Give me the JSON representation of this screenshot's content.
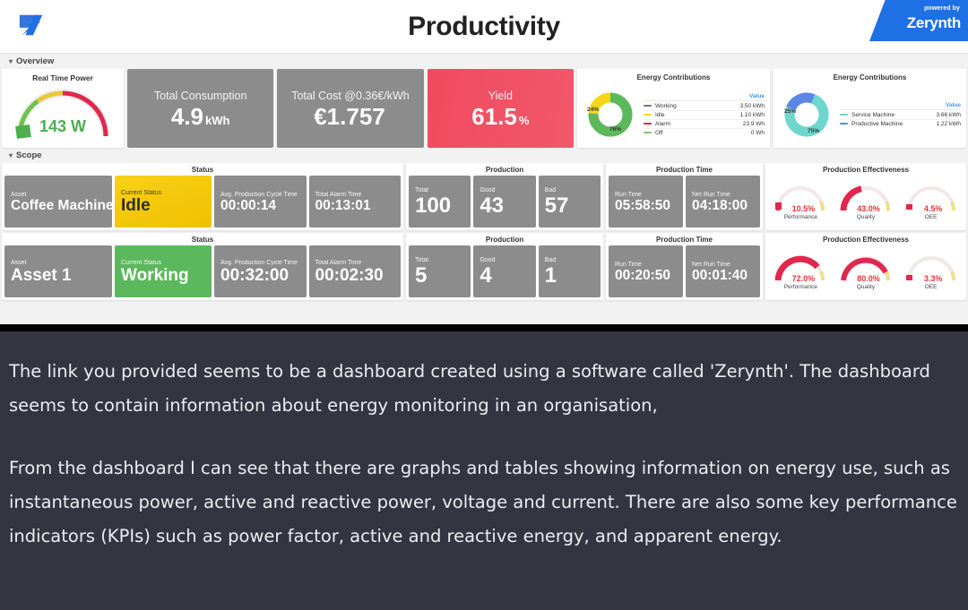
{
  "header": {
    "title": "Productivity",
    "logo_icon": "zerynth-z-logo-icon",
    "badge_line1": "powered by",
    "badge_line2": "Zerynth"
  },
  "sections": {
    "overview_label": "Overview",
    "scope_label": "Scope"
  },
  "overview": {
    "realtime_power": {
      "title": "Real Time Power",
      "value": "143 W",
      "numeric": 143,
      "color": "#4caf50"
    },
    "kpis": [
      {
        "label": "Total Consumption",
        "value": "4.9",
        "unit": "kWh",
        "style": "grey"
      },
      {
        "label": "Total Cost @0.36€/kWh",
        "value": "€1.757",
        "unit": "",
        "style": "grey"
      },
      {
        "label": "Yield",
        "value": "61.5",
        "unit": "%",
        "style": "red"
      }
    ],
    "energy_contributions_1": {
      "title": "Energy Contributions",
      "value_header": "Value",
      "slices": [
        {
          "label": "Working",
          "value": "3.50 kWh",
          "pct": 76,
          "pct_label": "76%",
          "color": "#5cb85c"
        },
        {
          "label": "Idle",
          "value": "1.10 kWh",
          "pct": 24,
          "pct_label": "24%",
          "color": "#f5d618"
        },
        {
          "label": "Alarm",
          "value": "23.9 Wh",
          "pct": 0,
          "pct_label": "",
          "color": "#e8174a"
        },
        {
          "label": "Off",
          "value": "0 Wh",
          "pct": 0,
          "pct_label": "",
          "color": "#7cc47c"
        }
      ]
    },
    "energy_contributions_2": {
      "title": "Energy Contributions",
      "value_header": "Value",
      "slices": [
        {
          "label": "Service Machine",
          "value": "3.66 kWh",
          "pct": 75,
          "pct_label": "75%",
          "color": "#6dd6cd"
        },
        {
          "label": "Productive Machine",
          "value": "1.22 kWh",
          "pct": 25,
          "pct_label": "25%",
          "color": "#5b86e5"
        }
      ]
    }
  },
  "scope": {
    "group_titles": {
      "status": "Status",
      "production": "Production",
      "production_time": "Production Time",
      "effectiveness": "Production Effectiveness"
    },
    "tile_labels": {
      "asset": "Asset",
      "current_status": "Current Status",
      "avg_cycle": "Avg. Production Cycle Time",
      "total_alarm": "Total Alarm Time",
      "total": "Total",
      "good": "Good",
      "bad": "Bad",
      "run_time": "Run Time",
      "net_run_time": "Net Run Time",
      "performance": "Performance",
      "quality": "Quality",
      "oee": "OEE"
    },
    "rows": [
      {
        "asset": "Coffee Machine",
        "current_status": "Idle",
        "status_style": "yellow",
        "avg_cycle": "00:00:14",
        "total_alarm": "00:13:01",
        "total": "100",
        "good": "43",
        "bad": "57",
        "run_time": "05:58:50",
        "net_run_time": "04:18:00",
        "performance": "10.5%",
        "performance_pct": 10.5,
        "quality": "43.0%",
        "quality_pct": 43.0,
        "oee": "4.5%",
        "oee_pct": 4.5
      },
      {
        "asset": "Asset 1",
        "current_status": "Working",
        "status_style": "green",
        "avg_cycle": "00:32:00",
        "total_alarm": "00:02:30",
        "total": "5",
        "good": "4",
        "bad": "1",
        "run_time": "00:20:50",
        "net_run_time": "00:01:40",
        "performance": "72.0%",
        "performance_pct": 72.0,
        "quality": "80.0%",
        "quality_pct": 80.0,
        "oee": "3.3%",
        "oee_pct": 3.3
      }
    ]
  },
  "answer": {
    "paragraph1": "The link you provided seems to be a dashboard created using a software called 'Zerynth'. The dashboard seems to contain information about energy monitoring in an organisation,",
    "paragraph2": "From the dashboard I can see that there are graphs and tables showing information on energy use, such as instantaneous power, active and reactive power, voltage and current. There are also some key performance indicators (KPIs) such as power factor, active and reactive energy, and apparent energy."
  },
  "colors": {
    "accent_blue": "#1f6fe5",
    "kpi_grey": "#8c8c8c",
    "kpi_red": "#ef4b5f",
    "status_yellow": "#f5cc12",
    "status_green": "#5cb85c",
    "gauge_red": "#e1274d",
    "chat_bg": "#343541"
  }
}
